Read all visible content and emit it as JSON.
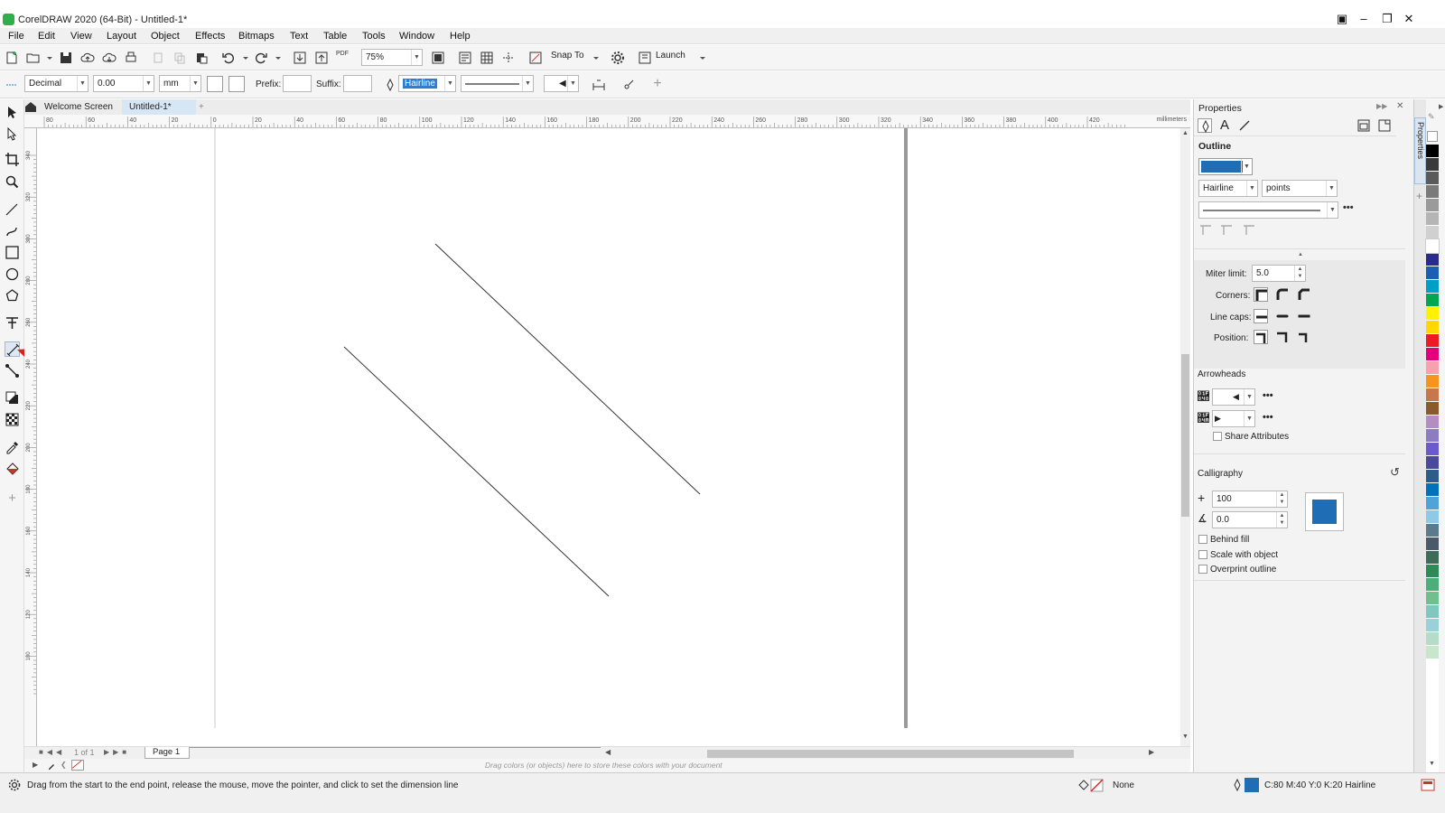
{
  "window": {
    "title": "CorelDRAW 2020 (64-Bit) - Untitled-1*"
  },
  "menu": [
    "File",
    "Edit",
    "View",
    "Layout",
    "Object",
    "Effects",
    "Bitmaps",
    "Text",
    "Table",
    "Tools",
    "Window",
    "Help"
  ],
  "standard_toolbar": {
    "zoom": "75%",
    "snap_label": "Snap To",
    "launch_label": "Launch",
    "pdf_label": "PDF"
  },
  "property_bar": {
    "dimension_style": "Decimal",
    "precision": "0.00",
    "units": "mm",
    "prefix_label": "Prefix:",
    "prefix_value": "",
    "suffix_label": "Suffix:",
    "suffix_value": "",
    "outline_width": "Hairline"
  },
  "tabs": {
    "welcome": "Welcome Screen",
    "document": "Untitled-1*",
    "add": "+"
  },
  "ruler": {
    "unit": "millimeters",
    "h_labels": [
      "80",
      "60",
      "40",
      "20",
      "0",
      "20",
      "40",
      "60",
      "80",
      "100",
      "120",
      "140",
      "160",
      "180",
      "200",
      "220",
      "240",
      "260",
      "280",
      "300",
      "320",
      "340",
      "360",
      "380",
      "400",
      "420"
    ],
    "v_labels": [
      "340",
      "320",
      "300",
      "280",
      "260",
      "240",
      "220",
      "200",
      "180",
      "160",
      "140",
      "120",
      "100"
    ]
  },
  "page_nav": {
    "page_counter": "1 of 1",
    "page_tab": "Page 1"
  },
  "color_tray": {
    "hint": "Drag colors (or objects) here to store these colors with your document"
  },
  "properties": {
    "title": "Properties",
    "outline_heading": "Outline",
    "outline_color": "#1f6eb5",
    "width": "Hairline",
    "width_units": "points",
    "miter_label": "Miter limit:",
    "miter_value": "5.0",
    "corners_label": "Corners:",
    "linecaps_label": "Line caps:",
    "position_label": "Position:",
    "arrowheads_heading": "Arrowheads",
    "share_attributes": "Share Attributes",
    "calligraphy_heading": "Calligraphy",
    "stretch_value": "100",
    "angle_value": "0.0",
    "behind_fill": "Behind fill",
    "scale_with_object": "Scale with object",
    "overprint_outline": "Overprint outline",
    "side_tab": "Properties"
  },
  "status": {
    "hint": "Drag from the start to the end point, release the mouse, move the pointer, and click to set the dimension line",
    "fill_label": "None",
    "outline_info": "C:80 M:40 Y:0 K:20  Hairline",
    "outline_swatch": "#1f6eb5"
  },
  "palette_colors": [
    "#000000",
    "#3a3a3a",
    "#5a5a5a",
    "#7a7a7a",
    "#9a9a9a",
    "#b5b5b5",
    "#d0d0d0",
    "#ffffff",
    "#2b2b8c",
    "#1a5fb4",
    "#00a0c6",
    "#00a651",
    "#fff200",
    "#ffd800",
    "#ed1c24",
    "#e4007c",
    "#f7a1b0",
    "#f7941d",
    "#c7774a",
    "#8b5a2b",
    "#b38ec2",
    "#8e7cc3",
    "#6a5acd",
    "#4a4a9c",
    "#2e5c8a",
    "#0072bc",
    "#4fa3d9",
    "#8ecae6",
    "#5b7a8c",
    "#4a5a6a",
    "#3e6b5a",
    "#2e8b57",
    "#4caf7a",
    "#6fbf8f",
    "#7ec8c0",
    "#9ad0d8",
    "#b4dcc8",
    "#c8e6c9"
  ]
}
